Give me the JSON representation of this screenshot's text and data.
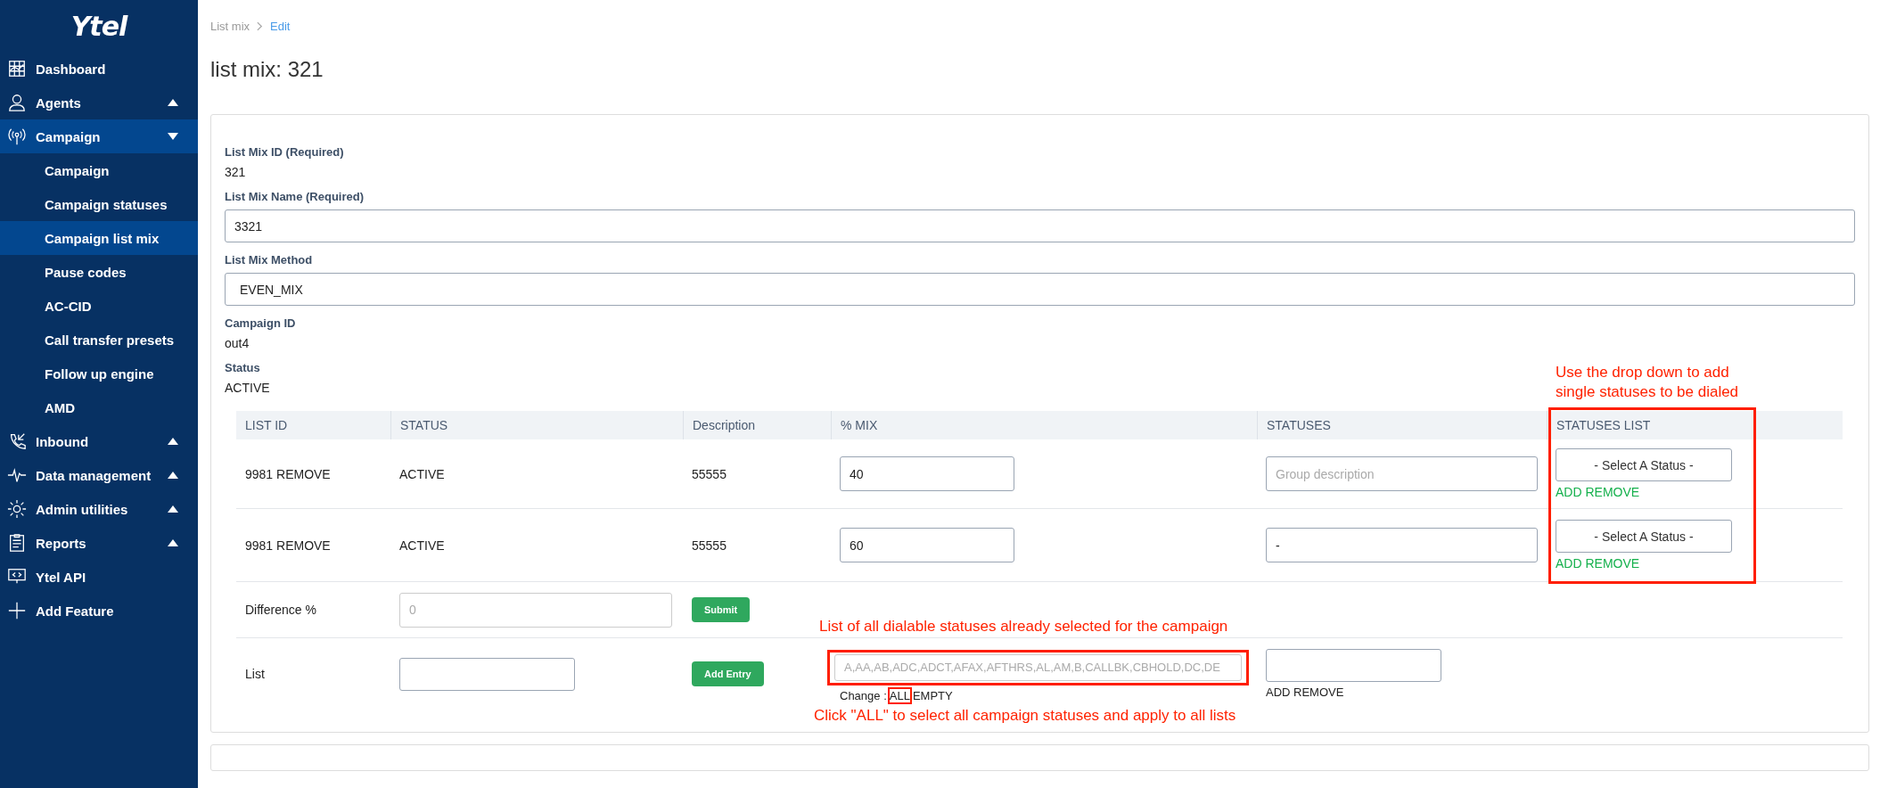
{
  "sidebar": {
    "logo": "Ytel",
    "items": [
      {
        "label": "Dashboard"
      },
      {
        "label": "Agents",
        "expanded": false
      },
      {
        "label": "Campaign",
        "expanded": true,
        "children": [
          {
            "label": "Campaign",
            "selected": false
          },
          {
            "label": "Campaign statuses",
            "selected": false
          },
          {
            "label": "Campaign list mix",
            "selected": true
          },
          {
            "label": "Pause codes",
            "selected": false
          },
          {
            "label": "AC-CID",
            "selected": false
          },
          {
            "label": "Call transfer presets",
            "selected": false
          },
          {
            "label": "Follow up engine",
            "selected": false
          },
          {
            "label": "AMD",
            "selected": false
          }
        ]
      },
      {
        "label": "Inbound",
        "expanded": false
      },
      {
        "label": "Data management",
        "expanded": false
      },
      {
        "label": "Admin utilities",
        "expanded": false
      },
      {
        "label": "Reports",
        "expanded": false
      },
      {
        "label": "Ytel API"
      },
      {
        "label": "Add Feature"
      }
    ]
  },
  "breadcrumb": [
    "List mix",
    "Edit"
  ],
  "title": "list mix: 321",
  "form": [
    {
      "kind": "static",
      "label": "List Mix ID (Required)",
      "value": "321"
    },
    {
      "kind": "input",
      "label": "List Mix Name (Required)",
      "value": "3321"
    },
    {
      "kind": "select",
      "label": "List Mix Method",
      "value": "EVEN_MIX"
    },
    {
      "kind": "static",
      "label": "Campaign ID",
      "value": "out4"
    },
    {
      "kind": "static",
      "label": "Status",
      "value": "ACTIVE"
    }
  ],
  "table": {
    "columns": [
      "LIST ID",
      "STATUS",
      "Description",
      "% MIX",
      "STATUSES",
      "STATUSES LIST"
    ],
    "rows": [
      {
        "list_id": "9981 REMOVE",
        "status": "ACTIVE",
        "description": "55555",
        "mix": "40",
        "statuses_placeholder": "Group description",
        "status_select": "- Select A Status -",
        "action": "ADD REMOVE"
      },
      {
        "list_id": "9981 REMOVE",
        "status": "ACTIVE",
        "description": "55555",
        "mix": "60",
        "statuses_value": "-",
        "status_select": "- Select A Status -",
        "action": "ADD REMOVE"
      }
    ],
    "difference": {
      "label": "Difference %",
      "placeholder": "0",
      "button": "Submit"
    },
    "list": {
      "label": "List",
      "button": "Add Entry",
      "statuses_placeholder": "A,AA,AB,ADC,ADCT,AFAX,AFTHRS,AL,AM,B,CALLBK,CBHOLD,DC,DE",
      "change_label": "Change :",
      "change_links": [
        "ALL",
        "EMPTY"
      ],
      "action": "ADD REMOVE"
    }
  },
  "annotations": [
    "Use the drop down to add single statuses to be dialed",
    "List of all dialable statuses already selected for the campaign",
    "Click \"ALL\" to select all campaign statuses and apply to all lists"
  ]
}
